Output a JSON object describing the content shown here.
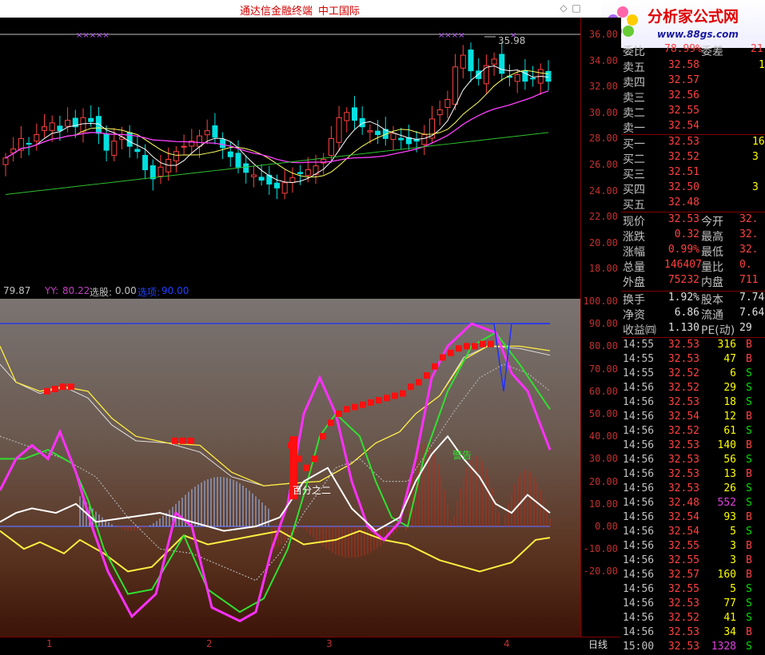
{
  "window": {
    "title": "通达信金融终端",
    "broker": "中工国际",
    "logo_text": "分析家公式网",
    "logo_url": "www.88gs.com"
  },
  "main_chart": {
    "price_axis": [
      "36.00",
      "34.00",
      "32.00",
      "30.00",
      "28.00",
      "26.00",
      "24.00",
      "22.00",
      "20.00",
      "18.00"
    ],
    "peak_label": "35.98"
  },
  "indicator_bar": {
    "xx": "79.87",
    "yy_label": "YY:",
    "yy": "80.22",
    "xuangu_label": "选股:",
    "xuangu": "0.00",
    "xuanxiang_label": "选项:",
    "xuanxiang": "90.00"
  },
  "indicator_axis": [
    "100.00",
    "90.00",
    "80.00",
    "70.00",
    "60.00",
    "50.00",
    "40.00",
    "30.00",
    "20.00",
    "10.00",
    "0.00",
    "-10.00",
    "-20.00"
  ],
  "indicator_labels": {
    "baifenzhier": "百分之二",
    "jinggao": "警告"
  },
  "date_axis": {
    "ticks": [
      "1",
      "2",
      "3",
      "4"
    ],
    "period": "日线"
  },
  "quote": {
    "weibi_label": "委比",
    "weibi": "78.99%",
    "weicha_label": "委差",
    "weicha": "21",
    "sell": [
      {
        "label": "卖五",
        "price": "32.58",
        "vol": "1"
      },
      {
        "label": "卖四",
        "price": "32.57",
        "vol": ""
      },
      {
        "label": "卖三",
        "price": "32.56",
        "vol": ""
      },
      {
        "label": "卖二",
        "price": "32.55",
        "vol": ""
      },
      {
        "label": "卖一",
        "price": "32.54",
        "vol": ""
      }
    ],
    "buy": [
      {
        "label": "买一",
        "price": "32.53",
        "vol": "16"
      },
      {
        "label": "买二",
        "price": "32.52",
        "vol": "3"
      },
      {
        "label": "买三",
        "price": "32.51",
        "vol": ""
      },
      {
        "label": "买四",
        "price": "32.50",
        "vol": "3"
      },
      {
        "label": "买五",
        "price": "32.48",
        "vol": ""
      }
    ],
    "stats": [
      {
        "l1": "现价",
        "v1": "32.53",
        "l2": "今开",
        "v2": "32."
      },
      {
        "l1": "涨跌",
        "v1": "0.32",
        "l2": "最高",
        "v2": "32."
      },
      {
        "l1": "涨幅",
        "v1": "0.99%",
        "l2": "最低",
        "v2": "32."
      },
      {
        "l1": "总量",
        "v1": "146407",
        "l2": "量比",
        "v2": "0."
      },
      {
        "l1": "外盘",
        "v1": "75232",
        "l2": "内盘",
        "v2": "711"
      }
    ],
    "fundamentals": [
      {
        "l1": "换手",
        "v1": "1.92%",
        "l2": "股本",
        "v2": "7.74"
      },
      {
        "l1": "净资",
        "v1": "6.86",
        "l2": "流通",
        "v2": "7.64"
      },
      {
        "l1": "收益㈣",
        "v1": "1.130",
        "l2": "PE(动)",
        "v2": "29"
      }
    ]
  },
  "ticks": [
    {
      "t": "14:55",
      "p": "32.53",
      "v": "316",
      "d": "B"
    },
    {
      "t": "14:55",
      "p": "32.53",
      "v": "47",
      "d": "B"
    },
    {
      "t": "14:55",
      "p": "32.52",
      "v": "6",
      "d": "S"
    },
    {
      "t": "14:56",
      "p": "32.52",
      "v": "29",
      "d": "S"
    },
    {
      "t": "14:56",
      "p": "32.53",
      "v": "18",
      "d": "S"
    },
    {
      "t": "14:56",
      "p": "32.54",
      "v": "12",
      "d": "B"
    },
    {
      "t": "14:56",
      "p": "32.52",
      "v": "61",
      "d": "S"
    },
    {
      "t": "14:56",
      "p": "32.53",
      "v": "140",
      "d": "B"
    },
    {
      "t": "14:56",
      "p": "32.53",
      "v": "56",
      "d": "S"
    },
    {
      "t": "14:56",
      "p": "32.53",
      "v": "13",
      "d": "B"
    },
    {
      "t": "14:56",
      "p": "32.53",
      "v": "26",
      "d": "S"
    },
    {
      "t": "14:56",
      "p": "32.48",
      "v": "552",
      "d": "S"
    },
    {
      "t": "14:56",
      "p": "32.54",
      "v": "93",
      "d": "B"
    },
    {
      "t": "14:56",
      "p": "32.54",
      "v": "5",
      "d": "S"
    },
    {
      "t": "14:56",
      "p": "32.55",
      "v": "3",
      "d": "B"
    },
    {
      "t": "14:56",
      "p": "32.55",
      "v": "3",
      "d": "B"
    },
    {
      "t": "14:56",
      "p": "32.57",
      "v": "160",
      "d": "B"
    },
    {
      "t": "14:56",
      "p": "32.55",
      "v": "5",
      "d": "S"
    },
    {
      "t": "14:56",
      "p": "32.53",
      "v": "77",
      "d": "S"
    },
    {
      "t": "14:56",
      "p": "32.52",
      "v": "41",
      "d": "S"
    },
    {
      "t": "14:56",
      "p": "32.53",
      "v": "34",
      "d": "B"
    },
    {
      "t": "15:00",
      "p": "32.53",
      "v": "1328",
      "d": "S"
    }
  ],
  "colors": {
    "up": "#ff4040",
    "down": "#00e0e0",
    "buy": "#ff4040",
    "sell": "#00e000",
    "axis": "#c03030",
    "bigvol": "#e040e0"
  }
}
